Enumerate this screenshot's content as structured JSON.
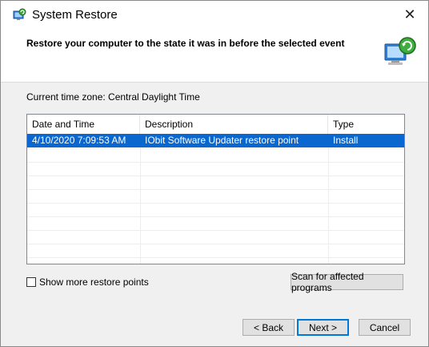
{
  "window": {
    "title": "System Restore",
    "close_glyph": "✕"
  },
  "header": {
    "title": "Restore your computer to the state it was in before the selected event"
  },
  "timezone": "Current time zone: Central Daylight Time",
  "table": {
    "columns": [
      "Date and Time",
      "Description",
      "Type"
    ],
    "rows": [
      {
        "date": "4/10/2020 7:09:53 AM",
        "description": "IObit Software Updater restore point",
        "type": "Install",
        "selected": true
      }
    ]
  },
  "checkbox": {
    "label": "Show more restore points",
    "checked": false
  },
  "buttons": {
    "scan": "Scan for affected programs",
    "back": "< Back",
    "next": "Next >",
    "cancel": "Cancel"
  },
  "colors": {
    "selection": "#0a67d0",
    "accent": "#0078d7"
  },
  "icons": [
    "system-restore-icon",
    "close-icon",
    "restore-header-icon",
    "sort-arrow-icon"
  ]
}
